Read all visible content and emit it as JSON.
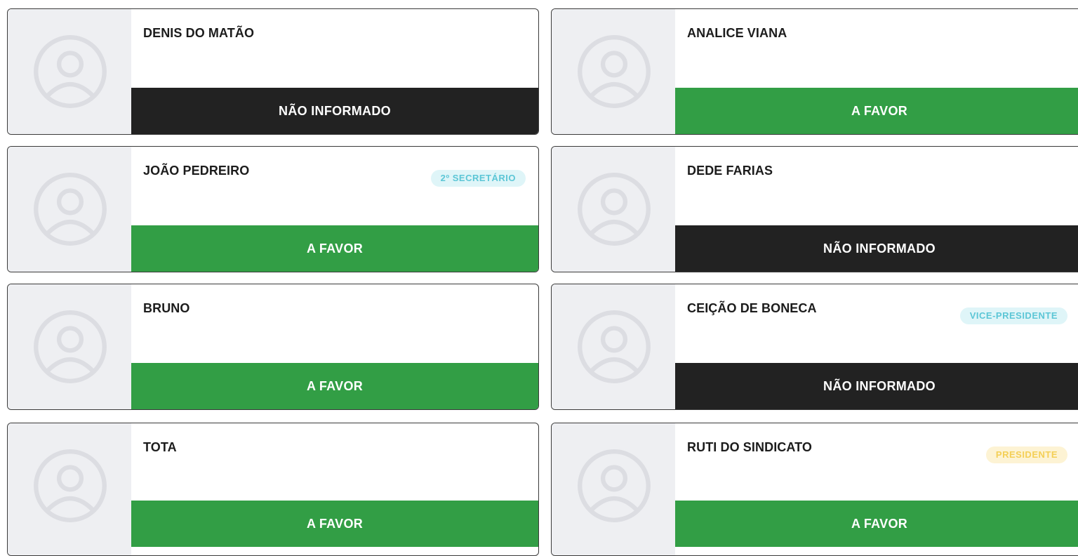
{
  "colors": {
    "favor": "#329e45",
    "not_informed": "#222222",
    "badge_cyan_bg": "#dff5f8",
    "badge_cyan_text": "#5cc6d6",
    "badge_yellow_bg": "#fdf3d4",
    "badge_yellow_text": "#f4cf56",
    "avatar_bg": "#eeeff2"
  },
  "members": [
    {
      "name": "DENIS DO MATÃO",
      "role": "",
      "vote": "NÃO INFORMADO",
      "vote_status": "not_informed",
      "avatar_icon": "user-placeholder-icon"
    },
    {
      "name": "ANALICE VIANA",
      "role": "",
      "vote": "A FAVOR",
      "vote_status": "favor",
      "avatar_icon": "user-placeholder-icon"
    },
    {
      "name": "JOÃO PEDREIRO",
      "role": "2º SECRETÁRIO",
      "vote": "A FAVOR",
      "vote_status": "favor",
      "avatar_icon": "user-placeholder-icon"
    },
    {
      "name": "DEDE FARIAS",
      "role": "",
      "vote": "NÃO INFORMADO",
      "vote_status": "not_informed",
      "avatar_icon": "user-placeholder-icon"
    },
    {
      "name": "BRUNO",
      "role": "",
      "vote": "A FAVOR",
      "vote_status": "favor",
      "avatar_icon": "user-placeholder-icon"
    },
    {
      "name": "CEIÇÃO DE BONECA",
      "role": "VICE-PRESIDENTE",
      "vote": "NÃO INFORMADO",
      "vote_status": "not_informed",
      "avatar_icon": "user-placeholder-icon"
    },
    {
      "name": "TOTA",
      "role": "",
      "vote": "A FAVOR",
      "vote_status": "favor",
      "avatar_icon": "user-placeholder-icon"
    },
    {
      "name": "RUTI DO SINDICATO",
      "role": "PRESIDENTE",
      "vote": "A FAVOR",
      "vote_status": "favor",
      "avatar_icon": "user-placeholder-icon"
    }
  ]
}
